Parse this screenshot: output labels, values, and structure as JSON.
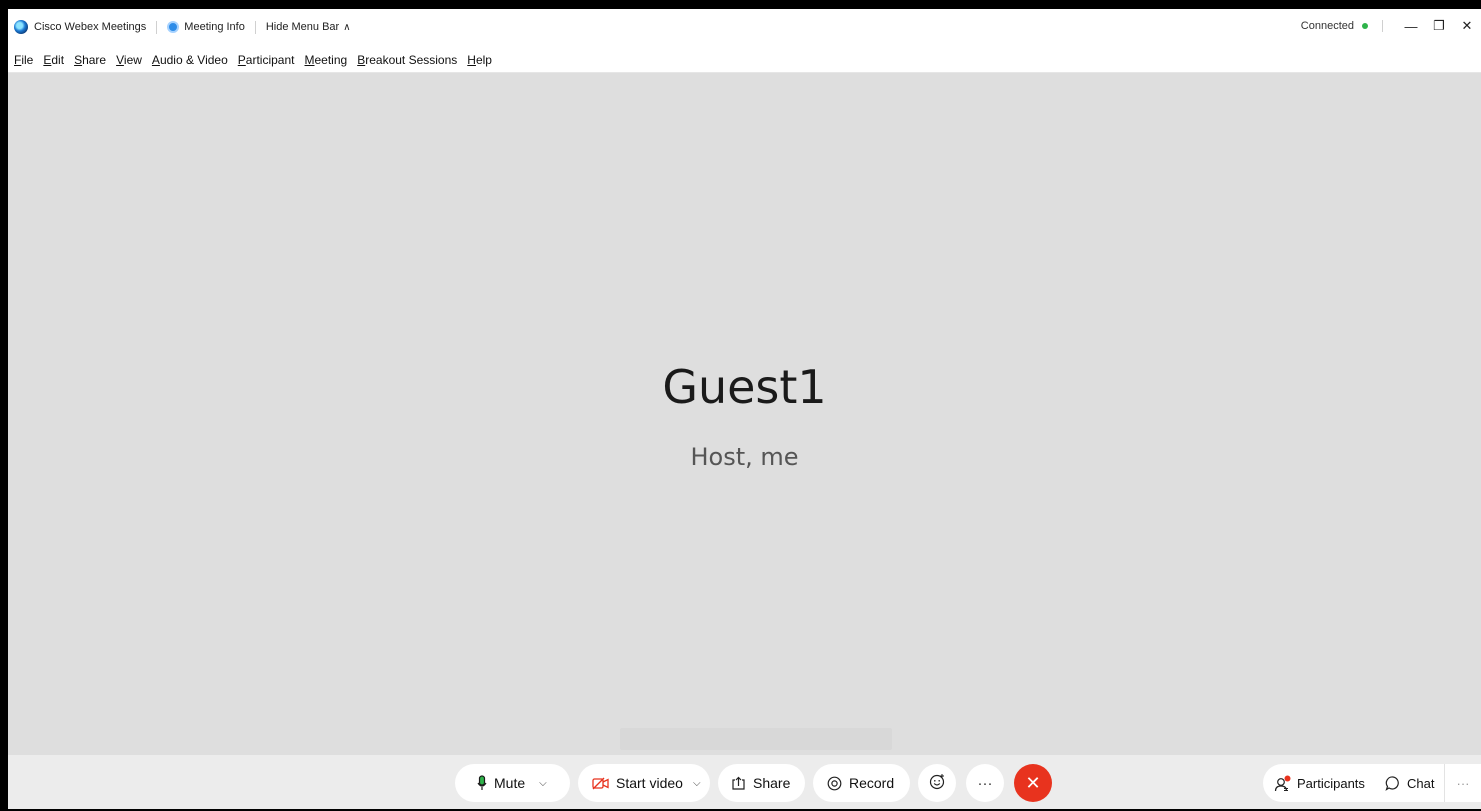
{
  "titlebar": {
    "app_name": "Cisco Webex Meetings",
    "meeting_info": "Meeting Info",
    "hide_menu_bar": "Hide Menu Bar",
    "status": "Connected",
    "status_color": "#2eb34a"
  },
  "menu": {
    "items": [
      "File",
      "Edit",
      "Share",
      "View",
      "Audio & Video",
      "Participant",
      "Meeting",
      "Breakout Sessions",
      "Help"
    ]
  },
  "stage": {
    "name": "Guest1",
    "role": "Host, me"
  },
  "controls": {
    "mute": "Mute",
    "start_video": "Start video",
    "share": "Share",
    "record": "Record",
    "more": "···",
    "end_color": "#e8331e",
    "participants": "Participants",
    "chat": "Chat"
  }
}
